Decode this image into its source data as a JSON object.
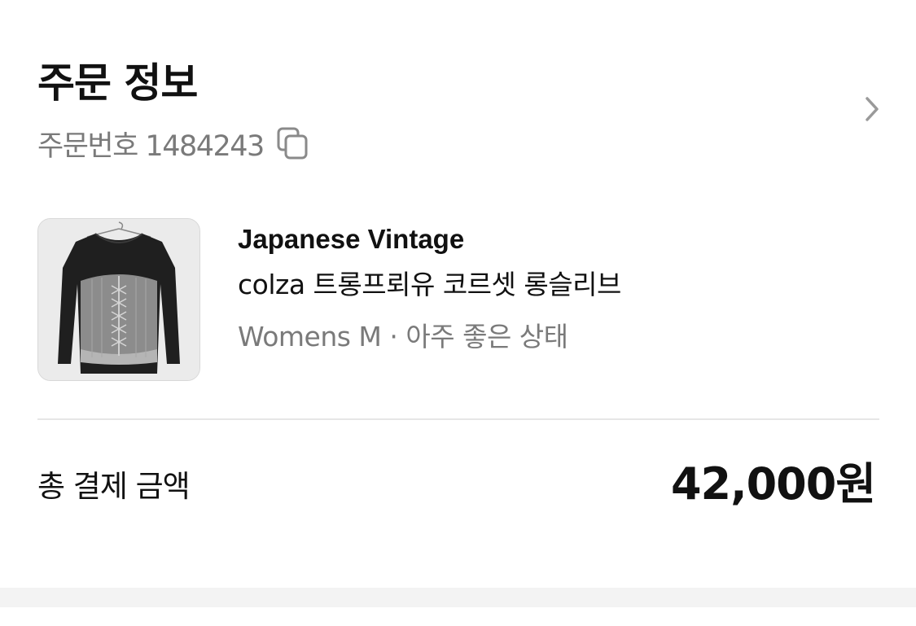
{
  "order": {
    "title": "주문 정보",
    "number_label": "주문번호 1484243",
    "copy_icon": "copy-icon",
    "detail_icon": "chevron-right-icon"
  },
  "product": {
    "brand": "Japanese Vintage",
    "name": "colza 트롱프뢰유 코르셋 롱슬리브",
    "meta": "Womens M · 아주 좋은 상태",
    "thumbnail": "black long-sleeve top with corset-lace print on hanger"
  },
  "payment": {
    "total_label": "총 결제 금액",
    "total_value": "42,000원"
  },
  "colors": {
    "text_primary": "#111111",
    "text_secondary": "#7a7a7a",
    "divider": "#e6e6e6",
    "section_gap": "#f3f3f3"
  }
}
